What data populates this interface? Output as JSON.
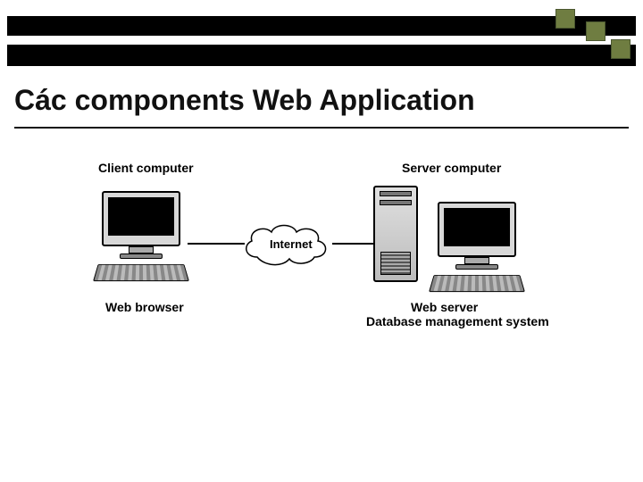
{
  "title": "Các components Web Application",
  "diagram": {
    "client_label_top": "Client computer",
    "server_label_top": "Server computer",
    "cloud_label": "Internet",
    "client_label_bottom": "Web browser",
    "server_label_bottom_1": "Web server",
    "server_label_bottom_2": "Database management system"
  }
}
